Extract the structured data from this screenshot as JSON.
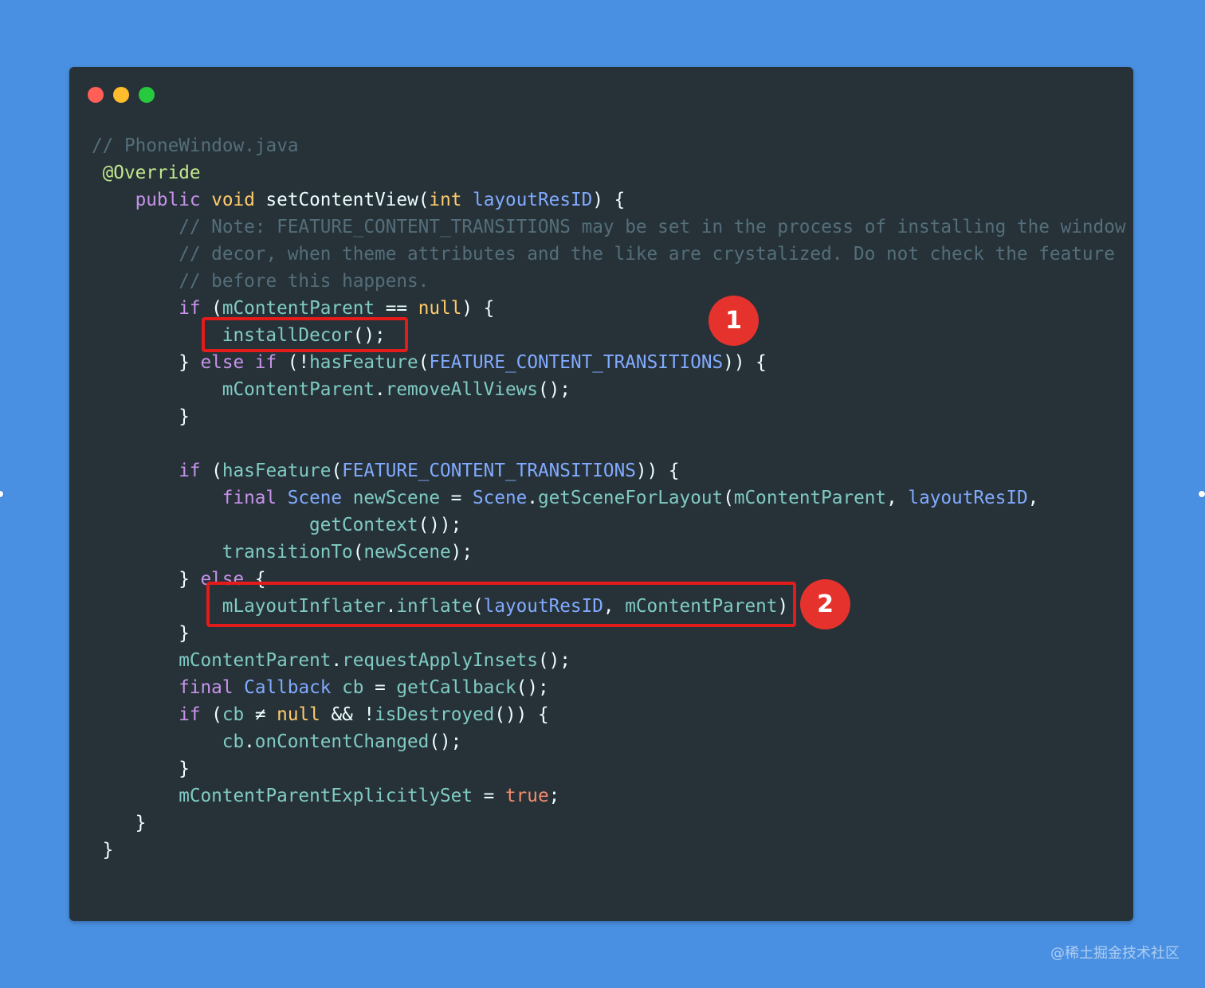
{
  "window": {
    "background": "#263238",
    "traffic_lights": [
      {
        "name": "close",
        "color": "#ff5f56"
      },
      {
        "name": "minimize",
        "color": "#ffbd2e"
      },
      {
        "name": "maximize",
        "color": "#27c93f"
      }
    ]
  },
  "code": {
    "lines": [
      {
        "indent": "",
        "tokens": [
          {
            "t": "// PhoneWindow.java",
            "c": "comment"
          }
        ]
      },
      {
        "indent": " ",
        "tokens": [
          {
            "t": "@Override",
            "c": "anno"
          }
        ]
      },
      {
        "indent": "    ",
        "tokens": [
          {
            "t": "public ",
            "c": "kw"
          },
          {
            "t": "void ",
            "c": "type"
          },
          {
            "t": "setContentView",
            "c": "plain"
          },
          {
            "t": "(",
            "c": "plain"
          },
          {
            "t": "int ",
            "c": "type"
          },
          {
            "t": "layoutResID",
            "c": "fn"
          },
          {
            "t": ") {",
            "c": "plain"
          }
        ]
      },
      {
        "indent": "        ",
        "tokens": [
          {
            "t": "// Note: FEATURE_CONTENT_TRANSITIONS may be set in the process of installing the window",
            "c": "comment"
          }
        ]
      },
      {
        "indent": "        ",
        "tokens": [
          {
            "t": "// decor, when theme attributes and the like are crystalized. Do not check the feature",
            "c": "comment"
          }
        ]
      },
      {
        "indent": "        ",
        "tokens": [
          {
            "t": "// before this happens.",
            "c": "comment"
          }
        ]
      },
      {
        "indent": "        ",
        "tokens": [
          {
            "t": "if ",
            "c": "kw"
          },
          {
            "t": "(",
            "c": "plain"
          },
          {
            "t": "mContentParent",
            "c": "var"
          },
          {
            "t": " == ",
            "c": "plain"
          },
          {
            "t": "null",
            "c": "type"
          },
          {
            "t": ") {",
            "c": "plain"
          }
        ]
      },
      {
        "indent": "            ",
        "tokens": [
          {
            "t": "installDecor",
            "c": "var"
          },
          {
            "t": "();",
            "c": "plain"
          }
        ]
      },
      {
        "indent": "        ",
        "tokens": [
          {
            "t": "} ",
            "c": "plain"
          },
          {
            "t": "else if ",
            "c": "kw"
          },
          {
            "t": "(!",
            "c": "plain"
          },
          {
            "t": "hasFeature",
            "c": "var"
          },
          {
            "t": "(",
            "c": "plain"
          },
          {
            "t": "FEATURE_CONTENT_TRANSITIONS",
            "c": "fn"
          },
          {
            "t": ")) {",
            "c": "plain"
          }
        ]
      },
      {
        "indent": "            ",
        "tokens": [
          {
            "t": "mContentParent",
            "c": "var"
          },
          {
            "t": ".",
            "c": "plain"
          },
          {
            "t": "removeAllViews",
            "c": "var"
          },
          {
            "t": "();",
            "c": "plain"
          }
        ]
      },
      {
        "indent": "        ",
        "tokens": [
          {
            "t": "}",
            "c": "plain"
          }
        ]
      },
      {
        "indent": "",
        "tokens": []
      },
      {
        "indent": "        ",
        "tokens": [
          {
            "t": "if ",
            "c": "kw"
          },
          {
            "t": "(",
            "c": "plain"
          },
          {
            "t": "hasFeature",
            "c": "var"
          },
          {
            "t": "(",
            "c": "plain"
          },
          {
            "t": "FEATURE_CONTENT_TRANSITIONS",
            "c": "fn"
          },
          {
            "t": ")) {",
            "c": "plain"
          }
        ]
      },
      {
        "indent": "            ",
        "tokens": [
          {
            "t": "final ",
            "c": "kw"
          },
          {
            "t": "Scene ",
            "c": "fn"
          },
          {
            "t": "newScene",
            "c": "var"
          },
          {
            "t": " = ",
            "c": "plain"
          },
          {
            "t": "Scene",
            "c": "fn"
          },
          {
            "t": ".",
            "c": "plain"
          },
          {
            "t": "getSceneForLayout",
            "c": "var"
          },
          {
            "t": "(",
            "c": "plain"
          },
          {
            "t": "mContentParent",
            "c": "var"
          },
          {
            "t": ", ",
            "c": "plain"
          },
          {
            "t": "layoutResID",
            "c": "fn"
          },
          {
            "t": ",",
            "c": "plain"
          }
        ]
      },
      {
        "indent": "                    ",
        "tokens": [
          {
            "t": "getContext",
            "c": "var"
          },
          {
            "t": "());",
            "c": "plain"
          }
        ]
      },
      {
        "indent": "            ",
        "tokens": [
          {
            "t": "transitionTo",
            "c": "var"
          },
          {
            "t": "(",
            "c": "plain"
          },
          {
            "t": "newScene",
            "c": "var"
          },
          {
            "t": ");",
            "c": "plain"
          }
        ]
      },
      {
        "indent": "        ",
        "tokens": [
          {
            "t": "} ",
            "c": "plain"
          },
          {
            "t": "else ",
            "c": "kw"
          },
          {
            "t": "{",
            "c": "plain"
          }
        ]
      },
      {
        "indent": "            ",
        "tokens": [
          {
            "t": "mLayoutInflater",
            "c": "var"
          },
          {
            "t": ".",
            "c": "plain"
          },
          {
            "t": "inflate",
            "c": "var"
          },
          {
            "t": "(",
            "c": "plain"
          },
          {
            "t": "layoutResID",
            "c": "fn"
          },
          {
            "t": ", ",
            "c": "plain"
          },
          {
            "t": "mContentParent",
            "c": "var"
          },
          {
            "t": ")",
            "c": "plain"
          }
        ]
      },
      {
        "indent": "        ",
        "tokens": [
          {
            "t": "}",
            "c": "plain"
          }
        ]
      },
      {
        "indent": "        ",
        "tokens": [
          {
            "t": "mContentParent",
            "c": "var"
          },
          {
            "t": ".",
            "c": "plain"
          },
          {
            "t": "requestApplyInsets",
            "c": "var"
          },
          {
            "t": "();",
            "c": "plain"
          }
        ]
      },
      {
        "indent": "        ",
        "tokens": [
          {
            "t": "final ",
            "c": "kw"
          },
          {
            "t": "Callback ",
            "c": "fn"
          },
          {
            "t": "cb",
            "c": "var"
          },
          {
            "t": " = ",
            "c": "plain"
          },
          {
            "t": "getCallback",
            "c": "var"
          },
          {
            "t": "();",
            "c": "plain"
          }
        ]
      },
      {
        "indent": "        ",
        "tokens": [
          {
            "t": "if ",
            "c": "kw"
          },
          {
            "t": "(",
            "c": "plain"
          },
          {
            "t": "cb",
            "c": "var"
          },
          {
            "t": " ≠ ",
            "c": "plain"
          },
          {
            "t": "null",
            "c": "type"
          },
          {
            "t": " && !",
            "c": "plain"
          },
          {
            "t": "isDestroyed",
            "c": "var"
          },
          {
            "t": "()) {",
            "c": "plain"
          }
        ]
      },
      {
        "indent": "            ",
        "tokens": [
          {
            "t": "cb",
            "c": "var"
          },
          {
            "t": ".",
            "c": "plain"
          },
          {
            "t": "onContentChanged",
            "c": "var"
          },
          {
            "t": "();",
            "c": "plain"
          }
        ]
      },
      {
        "indent": "        ",
        "tokens": [
          {
            "t": "}",
            "c": "plain"
          }
        ]
      },
      {
        "indent": "        ",
        "tokens": [
          {
            "t": "mContentParentExplicitlySet",
            "c": "var"
          },
          {
            "t": " = ",
            "c": "plain"
          },
          {
            "t": "true",
            "c": "const"
          },
          {
            "t": ";",
            "c": "plain"
          }
        ]
      },
      {
        "indent": "    ",
        "tokens": [
          {
            "t": "}",
            "c": "plain"
          }
        ]
      },
      {
        "indent": " ",
        "tokens": [
          {
            "t": "}",
            "c": "plain"
          }
        ]
      }
    ]
  },
  "annotations": [
    {
      "label": "1",
      "line": 7
    },
    {
      "label": "2",
      "line": 17
    }
  ],
  "watermark": "@稀土掘金技术社区",
  "colors": {
    "background": "#4a90e2",
    "highlight": "#e31b1b",
    "badge": "#e5322d"
  }
}
